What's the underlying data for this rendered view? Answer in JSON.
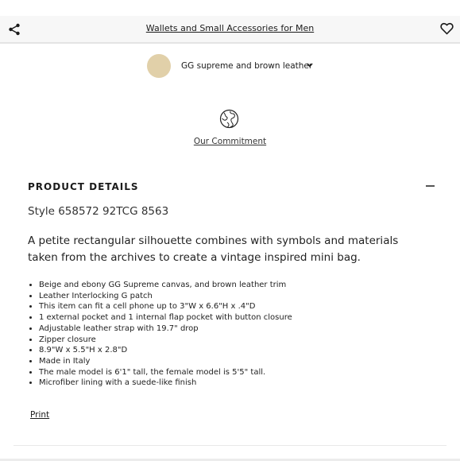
{
  "header": {
    "title": "Wallets and Small Accessories for Men",
    "share_icon": "share-icon",
    "favorite_icon": "heart-icon"
  },
  "variant": {
    "label": "GG supreme and brown leather",
    "swatch_color": "#e1d0a9"
  },
  "commitment": {
    "icon": "globe-icon",
    "label": "Our Commitment"
  },
  "product_details": {
    "heading": "PRODUCT DETAILS",
    "style": "Style 658572 92TCG 8563",
    "description": "A petite rectangular silhouette combines with symbols and materials taken from the archives to create a vintage inspired mini bag.",
    "bullets": [
      "Beige and ebony GG Supreme canvas, and brown leather trim",
      "Leather Interlocking G patch",
      "This item can fit a cell phone up to 3\"W x 6.6\"H x .4\"D",
      "1 external pocket and 1 internal flap pocket with button closure",
      "Adjustable leather strap with 19.7\" drop",
      "Zipper closure",
      "8.9\"W x 5.5\"H x 2.8\"D",
      "Made in Italy",
      "The male model is 6'1\" tall, the female model is 5'5\" tall.",
      "Microfiber lining with a suede-like finish"
    ],
    "print_label": "Print"
  }
}
